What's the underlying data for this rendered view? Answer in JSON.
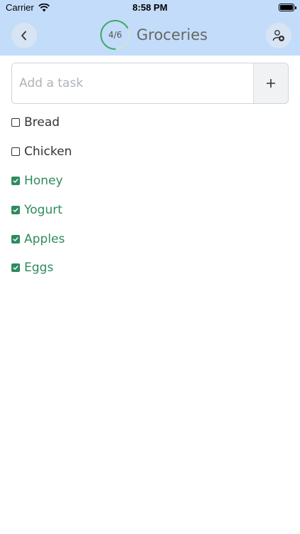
{
  "status_bar": {
    "carrier": "Carrier",
    "time": "8:58 PM",
    "wifi_icon": "wifi-icon",
    "battery_icon": "battery-icon"
  },
  "header": {
    "back_icon": "chevron-left-icon",
    "progress": {
      "label": "4/6",
      "done": 4,
      "total": 6,
      "color": "#3aaa6a"
    },
    "title": "Groceries",
    "user_icon": "add-user-icon",
    "background": "#c3dcf9"
  },
  "add_task": {
    "placeholder": "Add a task",
    "button_icon": "plus-icon"
  },
  "tasks": [
    {
      "label": "Bread",
      "checked": false
    },
    {
      "label": "Chicken",
      "checked": false
    },
    {
      "label": "Honey",
      "checked": true
    },
    {
      "label": "Yogurt",
      "checked": true
    },
    {
      "label": "Apples",
      "checked": true
    },
    {
      "label": "Eggs",
      "checked": true
    }
  ],
  "colors": {
    "accent": "#2e8b5e",
    "text": "#333333"
  }
}
